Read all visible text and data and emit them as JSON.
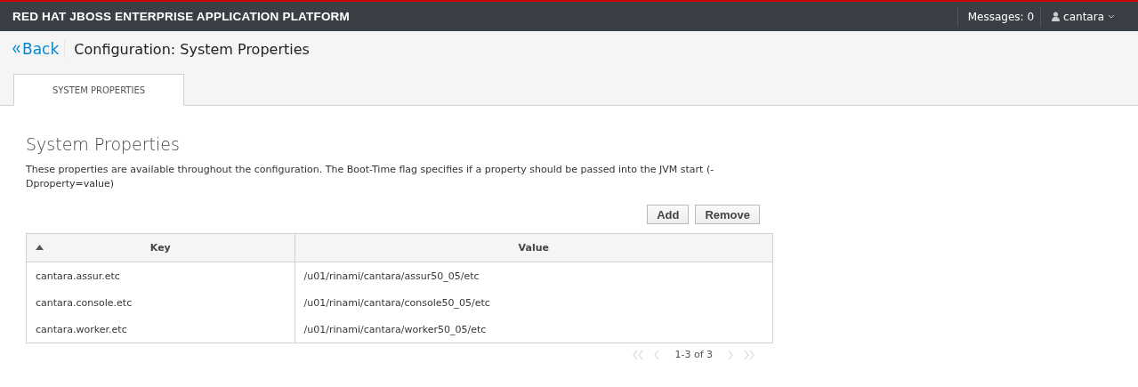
{
  "brand": "RED HAT JBOSS ENTERPRISE APPLICATION PLATFORM",
  "messages": "Messages: 0",
  "user": "cantara",
  "back": "Back",
  "page_title": "Configuration: System Properties",
  "tabs": [
    {
      "label": "SYSTEM PROPERTIES",
      "selected": true
    }
  ],
  "heading": "System Properties",
  "description": "These properties are available throughout the configuration. The Boot-Time flag specifies if a property should be passed into the JVM start (-Dproperty=value)",
  "buttons": [
    "Add",
    "Remove"
  ],
  "table": {
    "columns": [
      {
        "label": "Key",
        "sorted": true
      },
      {
        "label": "Value",
        "sorted": false
      }
    ],
    "rows": [
      [
        "cantara.assur.etc",
        "/u01/rinami/cantara/assur50_05/etc"
      ],
      [
        "cantara.console.etc",
        "/u01/rinami/cantara/console50_05/etc"
      ],
      [
        "cantara.worker.etc",
        "/u01/rinami/cantara/worker50_05/etc"
      ]
    ]
  },
  "pager": {
    "range": "1-3 of 3",
    "disabled": true
  }
}
